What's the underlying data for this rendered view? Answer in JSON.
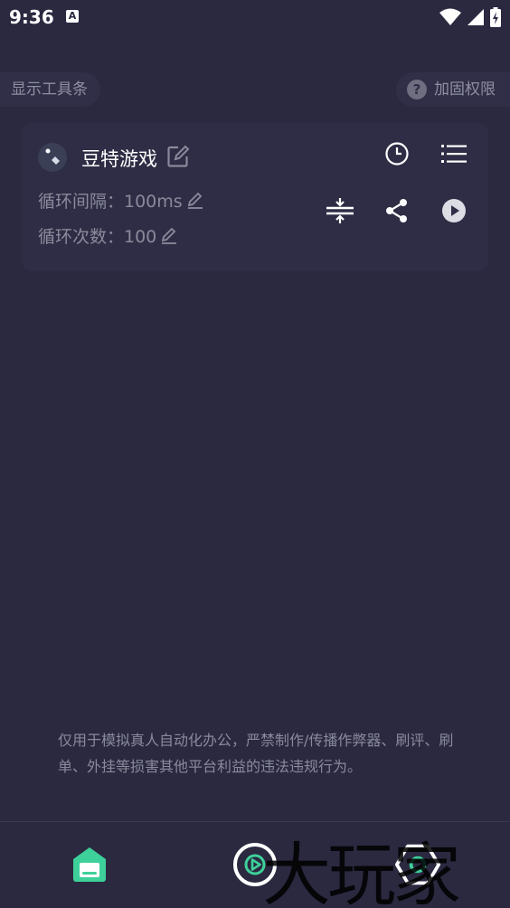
{
  "status_bar": {
    "time": "9:36",
    "notification_letter": "A"
  },
  "top": {
    "show_toolbar_label": "显示工具条",
    "reinforce_label": "加固权限",
    "help_symbol": "?"
  },
  "script_card": {
    "title": "豆特游戏",
    "interval_label": "循环间隔：100ms",
    "count_label": "循环次数：100"
  },
  "disclaimer": "仅用于模拟真人自动化办公，严禁制作/传播作弊器、刷评、刷单、外挂等损害其他平台利益的违法违规行为。",
  "watermark": "大玩家",
  "colors": {
    "background": "#2a2940",
    "card": "#2e2d45",
    "accent_green": "#3ed09a",
    "muted_text": "#8a8a9c"
  }
}
